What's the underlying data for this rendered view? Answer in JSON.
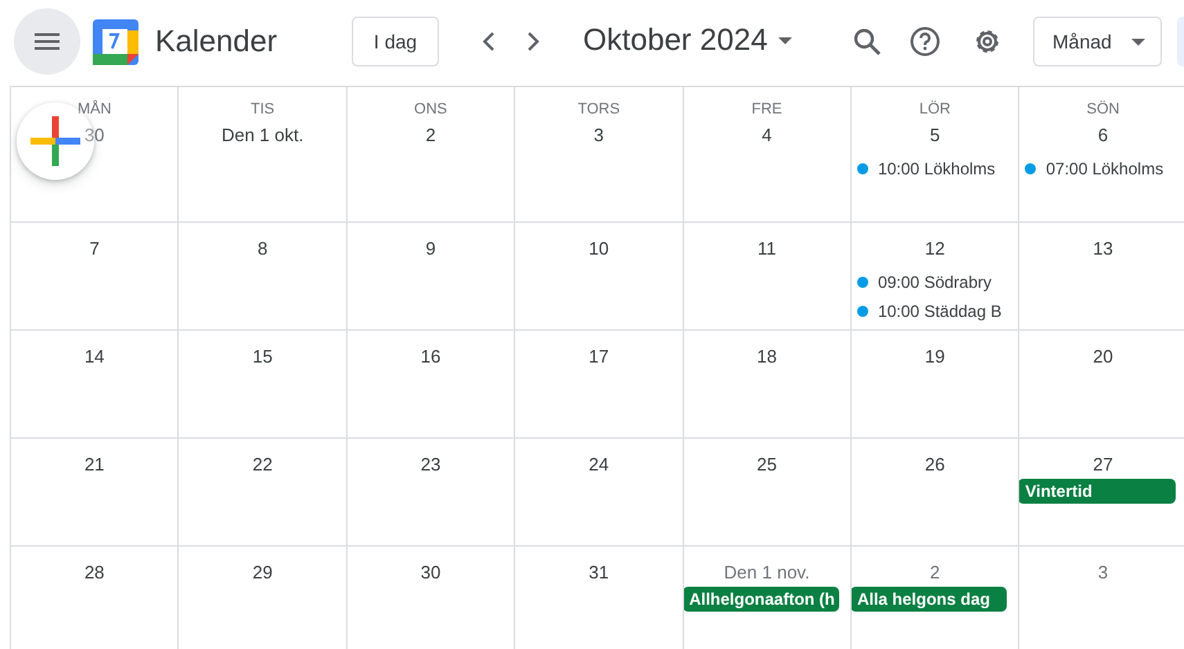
{
  "header": {
    "app_name": "Kalender",
    "today_button": "I dag",
    "period_title": "Oktober 2024",
    "view_button": "Månad"
  },
  "weekdays": [
    "MÅN",
    "TIS",
    "ONS",
    "TORS",
    "FRE",
    "LÖR",
    "SÖN"
  ],
  "weeks": [
    [
      {
        "label": "30",
        "muted": true
      },
      {
        "label": "Den 1 okt.",
        "muted": false
      },
      {
        "label": "2",
        "muted": false
      },
      {
        "label": "3",
        "muted": false
      },
      {
        "label": "4",
        "muted": false
      },
      {
        "label": "5",
        "muted": false,
        "events": [
          {
            "kind": "timed",
            "time": "10:00",
            "title": "Lökholms",
            "color": "#039be5"
          }
        ]
      },
      {
        "label": "6",
        "muted": false,
        "events": [
          {
            "kind": "timed",
            "time": "07:00",
            "title": "Lökholms",
            "color": "#039be5"
          }
        ]
      }
    ],
    [
      {
        "label": "7",
        "muted": false
      },
      {
        "label": "8",
        "muted": false
      },
      {
        "label": "9",
        "muted": false
      },
      {
        "label": "10",
        "muted": false
      },
      {
        "label": "11",
        "muted": false
      },
      {
        "label": "12",
        "muted": false,
        "events": [
          {
            "kind": "timed",
            "time": "09:00",
            "title": "Södrabry",
            "color": "#039be5"
          },
          {
            "kind": "timed",
            "time": "10:00",
            "title": "Städdag B",
            "color": "#039be5"
          }
        ]
      },
      {
        "label": "13",
        "muted": false
      }
    ],
    [
      {
        "label": "14",
        "muted": false
      },
      {
        "label": "15",
        "muted": false
      },
      {
        "label": "16",
        "muted": false
      },
      {
        "label": "17",
        "muted": false
      },
      {
        "label": "18",
        "muted": false
      },
      {
        "label": "19",
        "muted": false
      },
      {
        "label": "20",
        "muted": false
      }
    ],
    [
      {
        "label": "21",
        "muted": false
      },
      {
        "label": "22",
        "muted": false
      },
      {
        "label": "23",
        "muted": false
      },
      {
        "label": "24",
        "muted": false
      },
      {
        "label": "25",
        "muted": false
      },
      {
        "label": "26",
        "muted": false
      },
      {
        "label": "27",
        "muted": false,
        "events": [
          {
            "kind": "allday",
            "title": "Vintertid",
            "color": "#0b8043"
          }
        ]
      }
    ],
    [
      {
        "label": "28",
        "muted": false
      },
      {
        "label": "29",
        "muted": false
      },
      {
        "label": "30",
        "muted": false
      },
      {
        "label": "31",
        "muted": false
      },
      {
        "label": "Den 1 nov.",
        "muted": true,
        "events": [
          {
            "kind": "allday",
            "title": "Allhelgonaafton (h",
            "color": "#0b8043"
          }
        ]
      },
      {
        "label": "2",
        "muted": true,
        "events": [
          {
            "kind": "allday",
            "title": "Alla helgons dag",
            "color": "#0b8043"
          }
        ]
      },
      {
        "label": "3",
        "muted": true
      }
    ]
  ]
}
